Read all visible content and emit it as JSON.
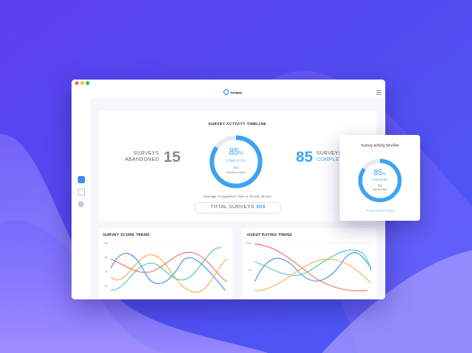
{
  "colors": {
    "background": "#5a4cf2",
    "accent": "#3ba3f2",
    "donut_track": "#e6eaf2"
  },
  "app": {
    "brand_name": "feebak",
    "brand_icon": "brand-logo-icon",
    "menu_icon": "menu-icon"
  },
  "sidebar": {
    "items": [
      {
        "icon": "dashboard-icon",
        "active": true
      },
      {
        "icon": "calendar-icon",
        "active": false
      },
      {
        "icon": "circle-icon",
        "active": false
      }
    ]
  },
  "timeline": {
    "title": "SURVEY ACTIVITY TIMELINE",
    "abandoned_label_1": "SURVEYS",
    "abandoned_label_2": "ABANDONED",
    "abandoned_value": "15",
    "completed_value": "85",
    "completed_label_1": "SURVEYS",
    "completed_label_2": "COMPLETED",
    "donut_percent": "85",
    "donut_percent_symbol": "%",
    "donut_percent_value": 85,
    "donut_completed_label": "COMPLETED",
    "donut_abandoned_value": "5%",
    "donut_abandoned_label": "ABANDONED",
    "avg_completion": "Average Completion Time is 36 min 45 sec",
    "total_label": "TOTAL",
    "total_surveys_word": "SURVEYS",
    "total_value": "454"
  },
  "score_trend": {
    "title": "SURVEY SCORE TREND",
    "y_ticks": [
      "100",
      "80",
      "70",
      "60"
    ]
  },
  "agent_trend": {
    "title": "AGENT RATING TREND",
    "y_ticks": [
      "100",
      "50"
    ]
  },
  "popup": {
    "title": "Survey activity timeline",
    "donut_percent": "85",
    "donut_percent_symbol": "%",
    "donut_percent_value": 85,
    "donut_completed_label": "COMPLETED",
    "donut_abandoned_value": "5%",
    "donut_abandoned_label": "ABANDONED",
    "total_text": "TOTAL SURVEYS 454"
  }
}
